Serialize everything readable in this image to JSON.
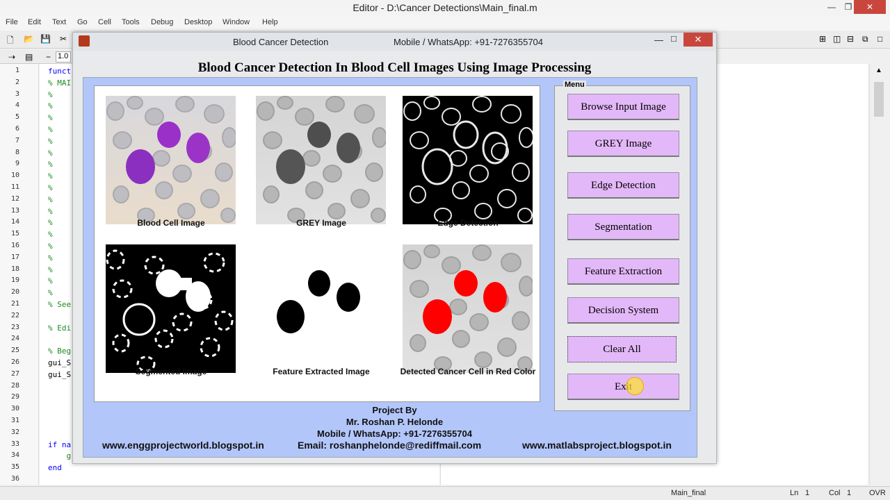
{
  "editor": {
    "title": "Editor - D:\\Cancer Detections\\Main_final.m",
    "menu": [
      "File",
      "Edit",
      "Text",
      "Go",
      "Cell",
      "Tools",
      "Debug",
      "Desktop",
      "Window",
      "Help"
    ],
    "zoom": "1.0",
    "line_numbers": [
      "1",
      "2",
      "3",
      "4",
      "5",
      "6",
      "7",
      "8",
      "9",
      "10",
      "11",
      "12",
      "13",
      "14",
      "15",
      "16",
      "17",
      "18",
      "19",
      "20",
      "21",
      "22",
      "23",
      "24",
      "25",
      "26",
      "27",
      "28",
      "29",
      "30",
      "31",
      "32",
      "33",
      "34",
      "35",
      "36"
    ],
    "code_lines": [
      "funct",
      "% MAI",
      "%",
      "%",
      "%",
      "%",
      "%",
      "%",
      "%",
      "%",
      "%",
      "%",
      "%",
      "%",
      "%",
      "%",
      "%",
      "%",
      "%",
      "%",
      "% See",
      "",
      "% Edi",
      "",
      "% Beg",
      "gui_S",
      "gui_S",
      "",
      "",
      "",
      "",
      "",
      "if na",
      "    g",
      "end",
      ""
    ],
    "status": {
      "file": "Main_final",
      "ln_label": "Ln",
      "ln": "1",
      "col_label": "Col",
      "col": "1",
      "mode": "OVR"
    }
  },
  "gui": {
    "title": "Blood Cancer Detection",
    "contact_title": "Mobile / WhatsApp: +91-7276355704",
    "heading": "Blood Cancer Detection In Blood Cell Images Using Image Processing",
    "menu_label": "Menu",
    "images": [
      {
        "caption": "Blood Cell Image"
      },
      {
        "caption": "GREY Image"
      },
      {
        "caption": "Edge Detection"
      },
      {
        "caption": "Segmented Image"
      },
      {
        "caption": "Feature Extracted Image"
      },
      {
        "caption": "Detected Cancer Cell in Red Color"
      }
    ],
    "buttons": [
      "Browse Input Image",
      "GREY Image",
      "Edge Detection",
      "Segmentation",
      "Feature Extraction",
      "Decision System",
      "Clear All",
      "Exit"
    ],
    "footer": {
      "project_by": "Project By",
      "author": "Mr. Roshan P. Helonde",
      "mobile": "Mobile / WhatsApp: +91-7276355704",
      "site_left": "www.enggprojectworld.blogspot.in",
      "email": "Email: roshanphelonde@rediffmail.com",
      "site_right": "www.matlabsproject.blogspot.in"
    }
  }
}
